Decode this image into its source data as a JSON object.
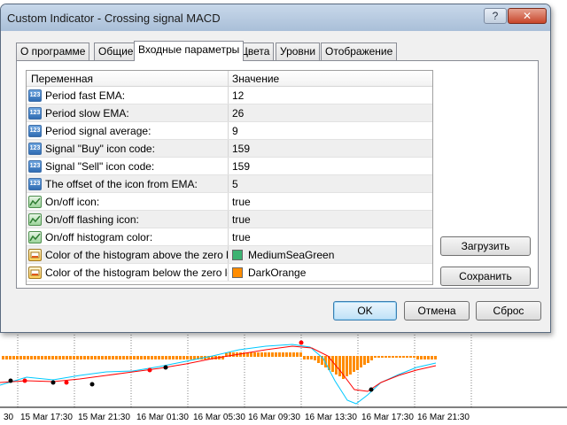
{
  "window": {
    "title": "Custom Indicator - Crossing signal MACD",
    "help_label": "?",
    "close_label": "✕"
  },
  "tabs": [
    {
      "label": "О программе",
      "active": false
    },
    {
      "label": "Общие",
      "active": false
    },
    {
      "label": "Входные параметры",
      "active": true
    },
    {
      "label": "Цвета",
      "active": false
    },
    {
      "label": "Уровни",
      "active": false
    },
    {
      "label": "Отображение",
      "active": false
    }
  ],
  "grid": {
    "headers": {
      "name": "Переменная",
      "value": "Значение"
    },
    "rows": [
      {
        "icon": "number-icon",
        "icon_text": "123",
        "name": "Period fast EMA:",
        "value": "12"
      },
      {
        "icon": "number-icon",
        "icon_text": "123",
        "name": "Period slow EMA:",
        "value": "26"
      },
      {
        "icon": "number-icon",
        "icon_text": "123",
        "name": "Period signal average:",
        "value": "9"
      },
      {
        "icon": "number-icon",
        "icon_text": "123",
        "name": "Signal \"Buy\" icon code:",
        "value": "159"
      },
      {
        "icon": "number-icon",
        "icon_text": "123",
        "name": "Signal \"Sell\" icon code:",
        "value": "159"
      },
      {
        "icon": "number-icon",
        "icon_text": "123",
        "name": "The offset of the icon from EMA:",
        "value": "5"
      },
      {
        "icon": "boolean-icon",
        "icon_text": "",
        "name": "On/off icon:",
        "value": "true"
      },
      {
        "icon": "boolean-icon",
        "icon_text": "",
        "name": "On/off flashing icon:",
        "value": "true"
      },
      {
        "icon": "boolean-icon",
        "icon_text": "",
        "name": "On/off histogram color:",
        "value": "true"
      },
      {
        "icon": "color-icon",
        "icon_text": "",
        "name": "Color of the histogram above the zero level:",
        "value": "MediumSeaGreen",
        "swatch": "#3cb371"
      },
      {
        "icon": "color-icon",
        "icon_text": "",
        "name": "Color of the histogram below the zero level:",
        "value": "DarkOrange",
        "swatch": "#ff8c00"
      }
    ]
  },
  "side_buttons": {
    "load": "Загрузить",
    "save": "Сохранить"
  },
  "footer_buttons": {
    "ok": "OK",
    "cancel": "Отмена",
    "reset": "Сброс"
  },
  "chart": {
    "time_labels": [
      "30",
      "15 Mar 17:30",
      "15 Mar 21:30",
      "16 Mar 01:30",
      "16 Mar 05:30",
      "16 Mar 09:30",
      "16 Mar 13:30",
      "16 Mar 17:30",
      "16 Mar 21:30"
    ],
    "colors": {
      "histogram": "#ff8c00",
      "fast_line": "#00c8ff",
      "slow_line": "#ff0000",
      "dots": "#000000",
      "dots_alt": "#ff0000",
      "grid": "#808080"
    }
  }
}
